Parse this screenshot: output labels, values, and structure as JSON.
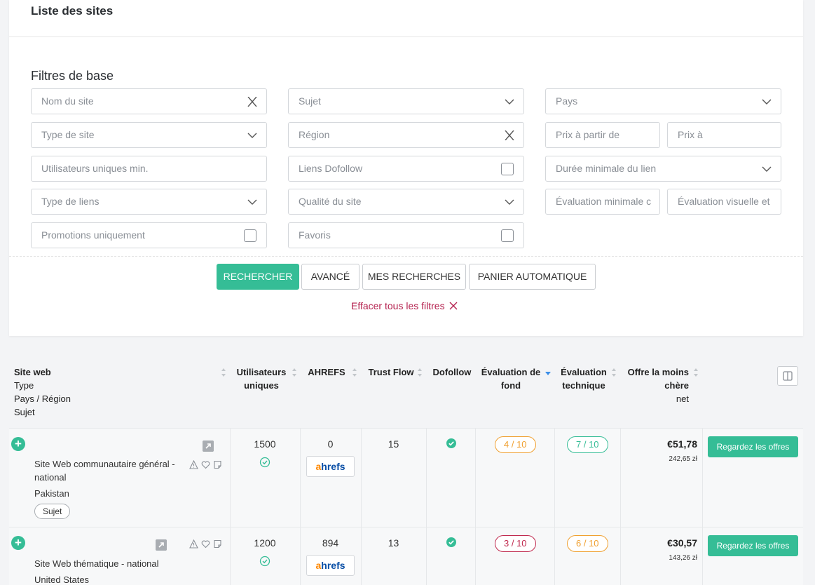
{
  "card_title": "Liste des sites",
  "filters": {
    "title": "Filtres de base",
    "site_name": "Nom du site",
    "subject": "Sujet",
    "country": "Pays",
    "site_type": "Type de site",
    "region": "Région",
    "price_from": "Prix à partir de",
    "price_to": "Prix à",
    "unique_users_min": "Utilisateurs uniques min.",
    "dofollow_links": "Liens Dofollow",
    "min_link_duration": "Durée minimale du lien",
    "link_type": "Type de liens",
    "site_quality": "Qualité du site",
    "min_rating": "Évaluation minimale c",
    "visual_rating": "Évaluation visuelle et",
    "promotions_only": "Promotions uniquement",
    "favorites": "Favoris"
  },
  "buttons": {
    "search": "RECHERCHER",
    "advanced": "AVANCÉ",
    "my_searches": "MES RECHERCHES",
    "auto_cart": "PANIER AUTOMATIQUE",
    "clear_filters": "Effacer tous les filtres"
  },
  "table": {
    "headers": {
      "site_line1": "Site web",
      "site_line2": "Type",
      "site_line3": "Pays / Région",
      "site_line4": "Sujet",
      "users_line1": "Utilisateurs",
      "users_line2": "uniques",
      "ahrefs": "AHREFS",
      "trust_flow": "Trust Flow",
      "dofollow": "Dofollow",
      "bg_line1": "Évaluation de",
      "bg_line2": "fond",
      "tech_line1": "Évaluation",
      "tech_line2": "technique",
      "offer_line1": "Offre la moins",
      "offer_line2": "chère",
      "offer_line3": "net"
    },
    "rows": [
      {
        "type_line1": "Site Web communautaire général -",
        "type_line2": "national",
        "country": "Pakistan",
        "tag": "Sujet",
        "users": "1500",
        "ahrefs": "0",
        "trust_flow": "15",
        "bg_rating": "4 / 10",
        "tech_rating": "7 / 10",
        "price": "€51,78",
        "price_sub": "242,65 zł",
        "offer": "Regardez les offres"
      },
      {
        "type_line1": "Site Web thématique - national",
        "country": "United States",
        "users": "1200",
        "ahrefs": "894",
        "trust_flow": "13",
        "bg_rating": "3 / 10",
        "tech_rating": "6 / 10",
        "price": "€30,57",
        "price_sub": "143,26 zł",
        "offer": "Regardez les offres"
      }
    ],
    "ahrefs_logo_a": "a",
    "ahrefs_logo_rest": "hrefs"
  },
  "colors": {
    "accent": "#35bd96",
    "danger": "#b4204e",
    "rating_orange": "#f0a030",
    "rating_red": "#c0294e",
    "rating_green": "#35bd96"
  }
}
